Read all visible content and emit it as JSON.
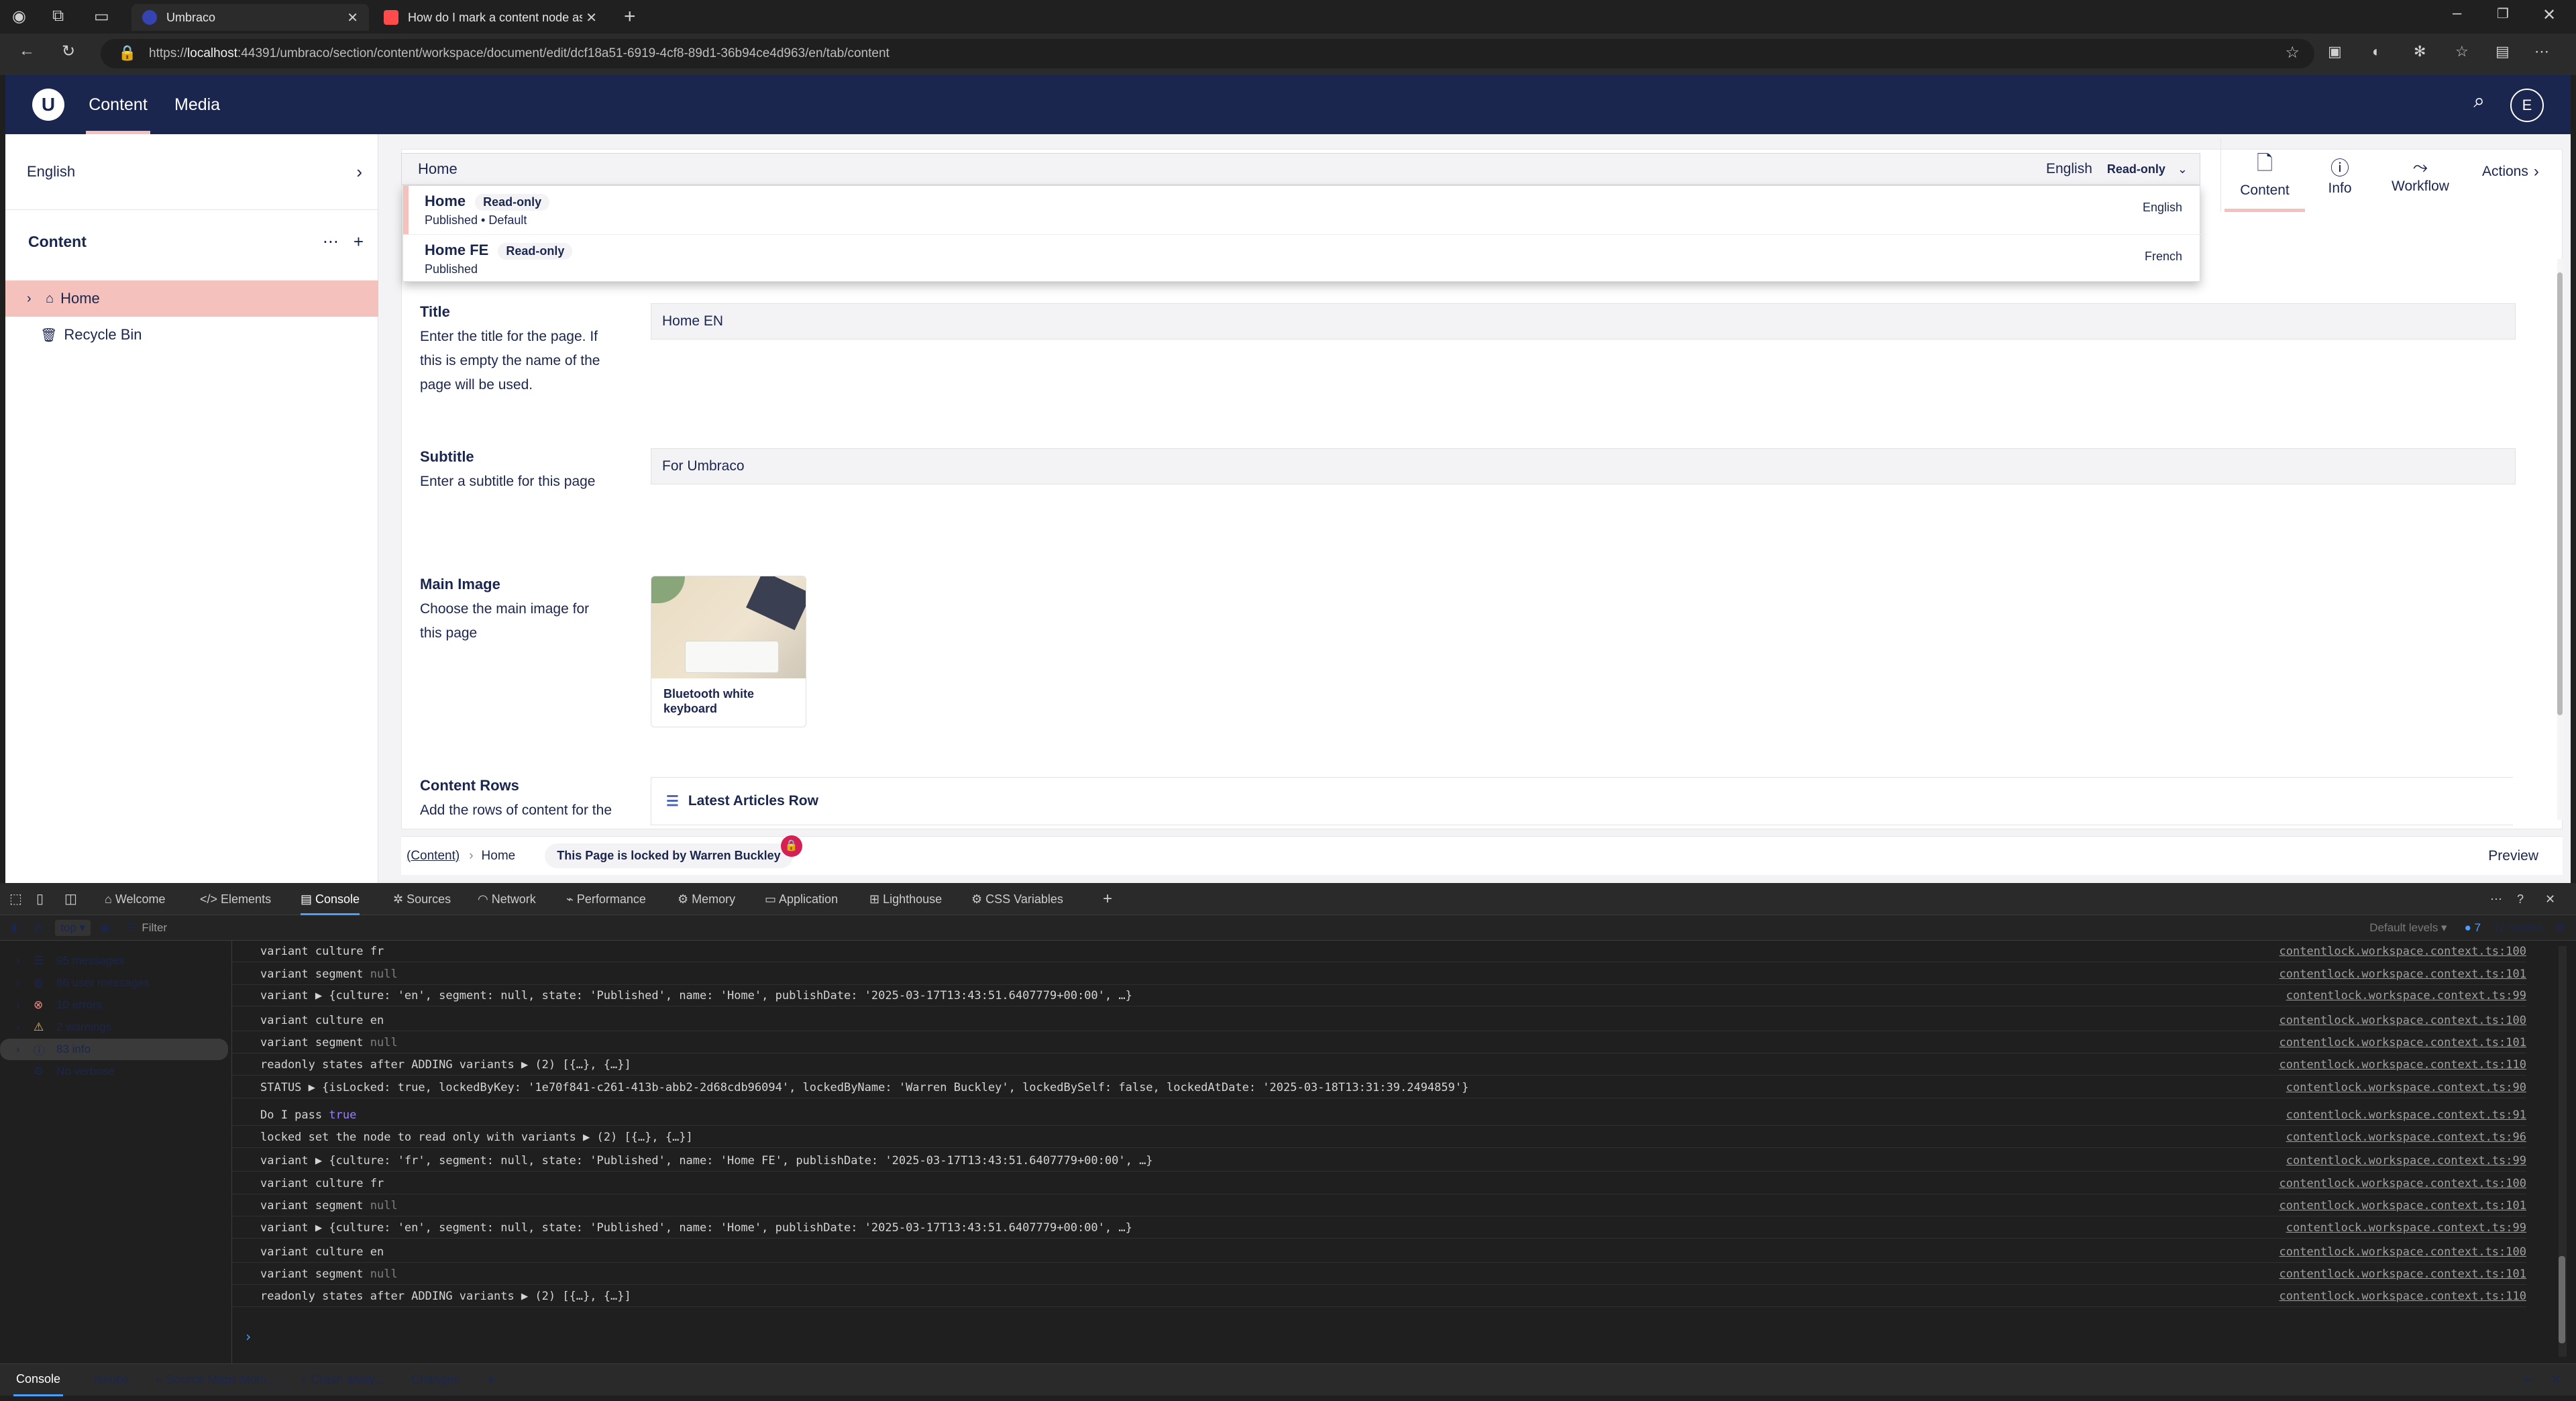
{
  "browser": {
    "tabs": [
      {
        "title": "Umbraco",
        "icon_color": "#3544b1"
      },
      {
        "title": "How do I mark a content node as",
        "icon_color": "#ff4b4b"
      }
    ],
    "url_prefix": "https://",
    "url_host": "localhost",
    "url_rest": ":44391/umbraco/section/content/workspace/document/edit/dcf18a51-6919-4cf8-89d1-36b94ce4d963/en/tab/content"
  },
  "app": {
    "logo": "U",
    "nav": {
      "content": "Content",
      "media": "Media"
    },
    "user_initial": "E",
    "sidebar": {
      "language": "English",
      "section_title": "Content",
      "tree": [
        {
          "label": "Home",
          "icon": "home-icon"
        },
        {
          "label": "Recycle Bin",
          "icon": "trash-icon"
        }
      ]
    },
    "document": {
      "name": "Home",
      "variant_lang": "English",
      "variant_state": "Read-only",
      "variants": [
        {
          "name": "Home",
          "tag": "Read-only",
          "status": "Published • Default",
          "lang": "English"
        },
        {
          "name": "Home FE",
          "tag": "Read-only",
          "status": "Published",
          "lang": "French"
        }
      ],
      "views": {
        "content": "Content",
        "info": "Info",
        "workflow": "Workflow",
        "actions": "Actions"
      },
      "properties": {
        "title": {
          "label": "Title",
          "desc": "Enter the title for the page. If this is empty the name of the page will be used.",
          "value": "Home EN"
        },
        "subtitle": {
          "label": "Subtitle",
          "desc": "Enter a subtitle for this page",
          "value": "For Umbraco"
        },
        "main_image": {
          "label": "Main Image",
          "desc": "Choose the main image for this page",
          "media_name": "Bluetooth white keyboard"
        },
        "content_rows": {
          "label": "Content Rows",
          "desc": "Add the rows of content for the",
          "row": "Latest Articles Row"
        }
      },
      "footer": {
        "breadcrumb_root": "(Content)",
        "breadcrumb_current": "Home",
        "lock_message": "This Page is locked by Warren Buckley",
        "preview": "Preview"
      }
    }
  },
  "devtools": {
    "tabs": {
      "welcome": "Welcome",
      "elements": "Elements",
      "console": "Console",
      "sources": "Sources",
      "network": "Network",
      "performance": "Performance",
      "memory": "Memory",
      "application": "Application",
      "lighthouse": "Lighthouse",
      "css_variables": "CSS Variables"
    },
    "context": "top",
    "filter_placeholder": "Filter",
    "levels": "Default levels",
    "issues_count": "7",
    "hidden": "12 hidden",
    "sidebar": [
      {
        "label": "95 messages",
        "icon": "list-icon"
      },
      {
        "label": "86 user messages",
        "icon": "user-icon"
      },
      {
        "label": "10 errors",
        "icon": "error-icon"
      },
      {
        "label": "2 warnings",
        "icon": "warning-icon"
      },
      {
        "label": "83 info",
        "icon": "info-icon"
      },
      {
        "label": "No verbose",
        "icon": "verbose-icon"
      }
    ],
    "logs": [
      {
        "text": "variant culture fr",
        "src": "contentlock.workspace.context.ts:100"
      },
      {
        "text": "variant segment ",
        "null": "null",
        "src": "contentlock.workspace.context.ts:101"
      },
      {
        "text": "variant  ▶ {culture: 'en', segment: null, state: 'Published', name: 'Home', publishDate: '2025-03-17T13:43:51.6407779+00:00', …}",
        "src": "contentlock.workspace.context.ts:99"
      },
      {
        "text": "variant culture en",
        "src": "contentlock.workspace.context.ts:100"
      },
      {
        "text": "variant segment ",
        "null": "null",
        "src": "contentlock.workspace.context.ts:101"
      },
      {
        "text": "readonly states after ADDING variants  ▶ (2) [{…}, {…}]",
        "src": "contentlock.workspace.context.ts:110"
      },
      {
        "text": "STATUS  ▶ {isLocked: true, lockedByKey: '1e70f841-c261-413b-abb2-2d68cdb96094', lockedByName: 'Warren Buckley', lockedBySelf: false, lockedAtDate: '2025-03-18T13:31:39.2494859'}",
        "src": "contentlock.workspace.context.ts:90"
      },
      {
        "text": "Do I pass ",
        "kw": "true",
        "src": "contentlock.workspace.context.ts:91"
      },
      {
        "text": "locked set the node to read only with variants  ▶ (2) [{…}, {…}]",
        "src": "contentlock.workspace.context.ts:96"
      },
      {
        "text": "variant  ▶ {culture: 'fr', segment: null, state: 'Published', name: 'Home FE', publishDate: '2025-03-17T13:43:51.6407779+00:00', …}",
        "src": "contentlock.workspace.context.ts:99"
      },
      {
        "text": "variant culture fr",
        "src": "contentlock.workspace.context.ts:100"
      },
      {
        "text": "variant segment ",
        "null": "null",
        "src": "contentlock.workspace.context.ts:101"
      },
      {
        "text": "variant  ▶ {culture: 'en', segment: null, state: 'Published', name: 'Home', publishDate: '2025-03-17T13:43:51.6407779+00:00', …}",
        "src": "contentlock.workspace.context.ts:99"
      },
      {
        "text": "variant culture en",
        "src": "contentlock.workspace.context.ts:100"
      },
      {
        "text": "variant segment ",
        "null": "null",
        "src": "contentlock.workspace.context.ts:101"
      },
      {
        "text": "readonly states after ADDING variants  ▶ (2) [{…}, {…}]",
        "src": "contentlock.workspace.context.ts:110"
      }
    ],
    "prompt": "›",
    "bottom_tabs": {
      "console": "Console",
      "issues": "Issues",
      "source_maps": "Source Maps Moni...",
      "crash": "Crash analy...",
      "changes": "Changes"
    }
  },
  "colors": {
    "umbraco_blue": "#1b264f",
    "highlight_pink": "#f5c1bc",
    "lock_red": "#d42054",
    "devtools_bg": "#1f1f1f"
  }
}
